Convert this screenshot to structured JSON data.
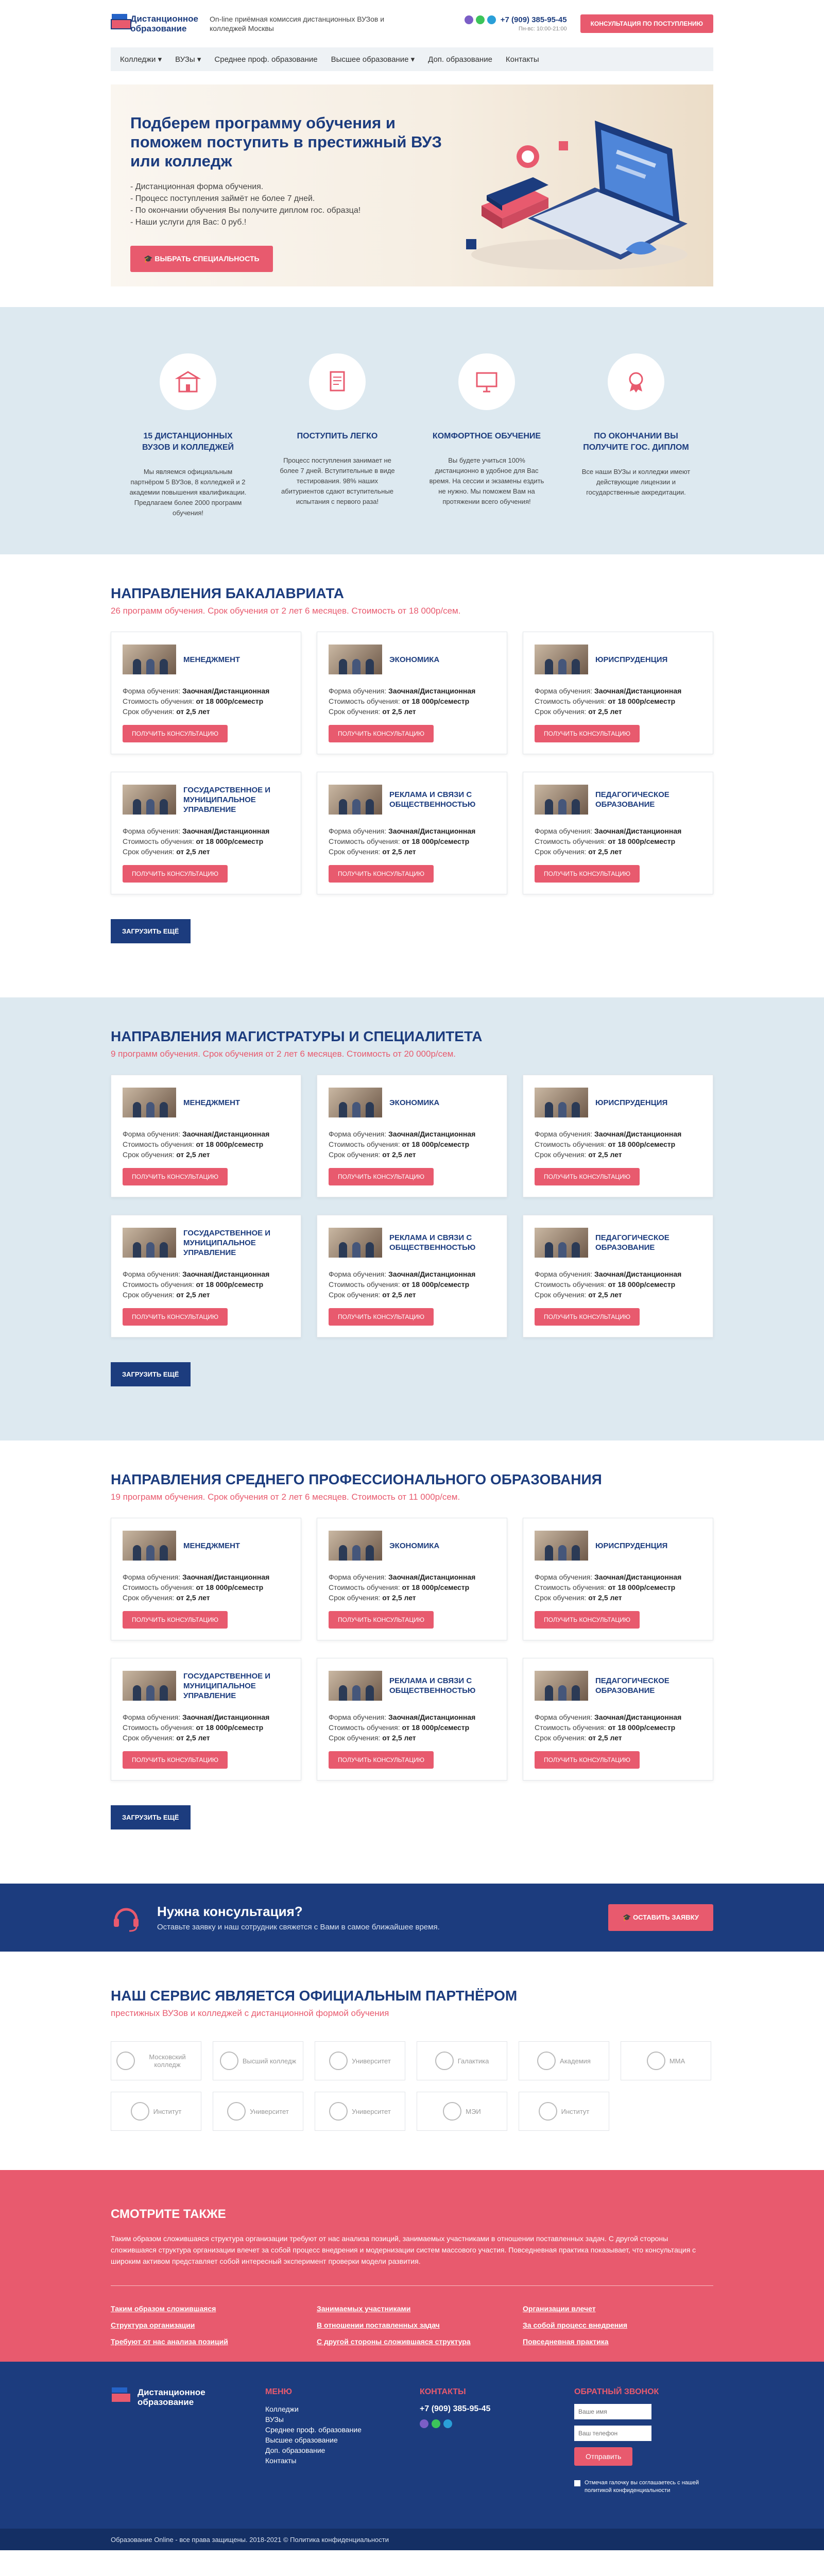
{
  "colors": {
    "brand": "#1c3c7e",
    "accent": "#e85a6e",
    "light": "#dde9f0"
  },
  "header": {
    "logo_line1": "Дистанционное",
    "logo_line2": "образование",
    "tagline": "On-line приёмная комиссия дистанционных ВУЗов и колледжей Москвы",
    "phone": "+7 (909) 385-95-45",
    "hours": "Пн-вс: 10:00-21:00",
    "consult_button": "Консультация по поступлению",
    "messengers": [
      "viber-icon",
      "whatsapp-icon",
      "telegram-icon"
    ]
  },
  "nav": [
    {
      "label": "Колледжи ▾"
    },
    {
      "label": "ВУЗы ▾"
    },
    {
      "label": "Среднее проф. образование"
    },
    {
      "label": "Высшее образование ▾"
    },
    {
      "label": "Доп. образование"
    },
    {
      "label": "Контакты"
    }
  ],
  "hero": {
    "title": "Подберем программу обучения и поможем поступить в престижный ВУЗ или колледж",
    "items": [
      "- Дистанционная форма обучения.",
      "- Процесс поступления займёт не более 7 дней.",
      "- По окончании обучения Вы получите диплом гос. образца!",
      "- Наши услуги для Вас: 0 руб.!"
    ],
    "button": "Выбрать специальность"
  },
  "features": [
    {
      "icon": "building-icon",
      "title": "15 дистанционных вузов и колледжей",
      "text": "Мы являемся официальным партнёром 5 ВУЗов, 8 колледжей и 2 академии повышения квалификации. Предлагаем более 2000 программ обучения!"
    },
    {
      "icon": "document-icon",
      "title": "Поступить легко",
      "text": "Процесс поступления занимает не более 7 дней. Вступительные в виде тестирования. 98% наших абитуриентов сдают вступительные испытания с первого раза!"
    },
    {
      "icon": "presentation-icon",
      "title": "Комфортное обучение",
      "text": "Вы будете учиться 100% дистанционно в удобное для Вас время. На сессии и экзамены ездить не нужно. Мы поможем Вам на протяжении всего обучения!"
    },
    {
      "icon": "diploma-icon",
      "title": "По окончании вы получите гос. диплом",
      "text": "Все наши ВУЗы и колледжи имеют действующие лицензии и государственные аккредитации."
    }
  ],
  "card_labels": {
    "form": "Форма обучения:",
    "cost": "Стоимость обучения:",
    "term": "Срок обучения:",
    "button": "Получить консультацию"
  },
  "sections": [
    {
      "title": "Направления бакалавриата",
      "subtitle": "26 программ обучения. Срок обучения от 2 лет 6 месяцев. Стоимость от 18 000р/сем.",
      "load": "Загрузить ещё",
      "cards": [
        {
          "title": "Менеджмент",
          "form": "Заочная/Дистанционная",
          "cost": "от 18 000р/семестр",
          "term": "от 2,5 лет"
        },
        {
          "title": "Экономика",
          "form": "Заочная/Дистанционная",
          "cost": "от 18 000р/семестр",
          "term": "от 2,5 лет"
        },
        {
          "title": "Юриспруденция",
          "form": "Заочная/Дистанционная",
          "cost": "от 18 000р/семестр",
          "term": "от 2,5 лет"
        },
        {
          "title": "Государственное и муниципальное управление",
          "form": "Заочная/Дистанционная",
          "cost": "от 18 000р/семестр",
          "term": "от 2,5 лет"
        },
        {
          "title": "Реклама и связи с общественностью",
          "form": "Заочная/Дистанционная",
          "cost": "от 18 000р/семестр",
          "term": "от 2,5 лет"
        },
        {
          "title": "Педагогическое образование",
          "form": "Заочная/Дистанционная",
          "cost": "от 18 000р/семестр",
          "term": "от 2,5 лет"
        }
      ]
    },
    {
      "title": "Направления магистратуры и специалитета",
      "subtitle": "9 программ обучения. Срок обучения от 2 лет 6 месяцев. Стоимость от 20 000р/сем.",
      "load": "Загрузить ещё",
      "cards": [
        {
          "title": "Менеджмент",
          "form": "Заочная/Дистанционная",
          "cost": "от 18 000р/семестр",
          "term": "от 2,5 лет"
        },
        {
          "title": "Экономика",
          "form": "Заочная/Дистанционная",
          "cost": "от 18 000р/семестр",
          "term": "от 2,5 лет"
        },
        {
          "title": "Юриспруденция",
          "form": "Заочная/Дистанционная",
          "cost": "от 18 000р/семестр",
          "term": "от 2,5 лет"
        },
        {
          "title": "Государственное и муниципальное управление",
          "form": "Заочная/Дистанционная",
          "cost": "от 18 000р/семестр",
          "term": "от 2,5 лет"
        },
        {
          "title": "Реклама и связи с общественностью",
          "form": "Заочная/Дистанционная",
          "cost": "от 18 000р/семестр",
          "term": "от 2,5 лет"
        },
        {
          "title": "Педагогическое образование",
          "form": "Заочная/Дистанционная",
          "cost": "от 18 000р/семестр",
          "term": "от 2,5 лет"
        }
      ]
    },
    {
      "title": "Направления среднего профессионального образования",
      "subtitle": "19 программ обучения. Срок обучения от 2 лет 6 месяцев. Стоимость от 11 000р/сем.",
      "load": "Загрузить ещё",
      "cards": [
        {
          "title": "Менеджмент",
          "form": "Заочная/Дистанционная",
          "cost": "от 18 000р/семестр",
          "term": "от 2,5 лет"
        },
        {
          "title": "Экономика",
          "form": "Заочная/Дистанционная",
          "cost": "от 18 000р/семестр",
          "term": "от 2,5 лет"
        },
        {
          "title": "Юриспруденция",
          "form": "Заочная/Дистанционная",
          "cost": "от 18 000р/семестр",
          "term": "от 2,5 лет"
        },
        {
          "title": "Государственное и муниципальное управление",
          "form": "Заочная/Дистанционная",
          "cost": "от 18 000р/семестр",
          "term": "от 2,5 лет"
        },
        {
          "title": "Реклама и связи с общественностью",
          "form": "Заочная/Дистанционная",
          "cost": "от 18 000р/семестр",
          "term": "от 2,5 лет"
        },
        {
          "title": "Педагогическое образование",
          "form": "Заочная/Дистанционная",
          "cost": "от 18 000р/семестр",
          "term": "от 2,5 лет"
        }
      ]
    }
  ],
  "consult": {
    "title": "Нужна консультация?",
    "text": "Оставьте заявку и наш сотрудник свяжется с Вами в самое ближайшее время.",
    "button": "Оставить заявку"
  },
  "partners": {
    "title": "Наш сервис является официальным партнёром",
    "subtitle": "престижных ВУЗов и колледжей с дистанционной формой обучения",
    "logos": [
      "Московский колледж",
      "Высший колледж",
      "Университет",
      "Галактика",
      "Академия",
      "ММА",
      "Институт",
      "Университет",
      "Университет",
      "МЭИ",
      "Институт"
    ]
  },
  "seealso": {
    "title": "Смотрите также",
    "text": "Таким образом сложившаяся структура организации требуют от нас анализа позиций, занимаемых участниками в отношении поставленных задач. С другой стороны сложившаяся структура организации влечет за собой процесс внедрения и модернизации систем массового участия. Повседневная практика показывает, что консультация с широким активом представляет собой интересный эксперимент проверки модели развития.",
    "cols": [
      [
        "Таким образом сложившаяся",
        "Структура организации",
        "Требуют от нас анализа позиций"
      ],
      [
        "Занимаемых участниками",
        "В отношении поставленных задач",
        "С другой стороны сложившаяся структура"
      ],
      [
        "Организации влечет",
        "За собой процесс внедрения",
        "Повседневная практика"
      ]
    ]
  },
  "footer": {
    "menu_title": "Меню",
    "menu": [
      "Колледжи",
      "ВУЗы",
      "Среднее проф. образование",
      "Высшее образование",
      "Доп. образование",
      "Контакты"
    ],
    "contacts_title": "Контакты",
    "phone": "+7 (909) 385-95-45",
    "callback_title": "Обратный звонок",
    "name_placeholder": "Ваше имя",
    "phone_placeholder": "Ваш телефон",
    "submit": "Отправить",
    "agree": "Отмечая галочку вы соглашаетесь с нашей политикой конфиденциальности",
    "copyright": "Образование Online - все права защищены. 2018-2021 © Политика конфиденциальности"
  }
}
